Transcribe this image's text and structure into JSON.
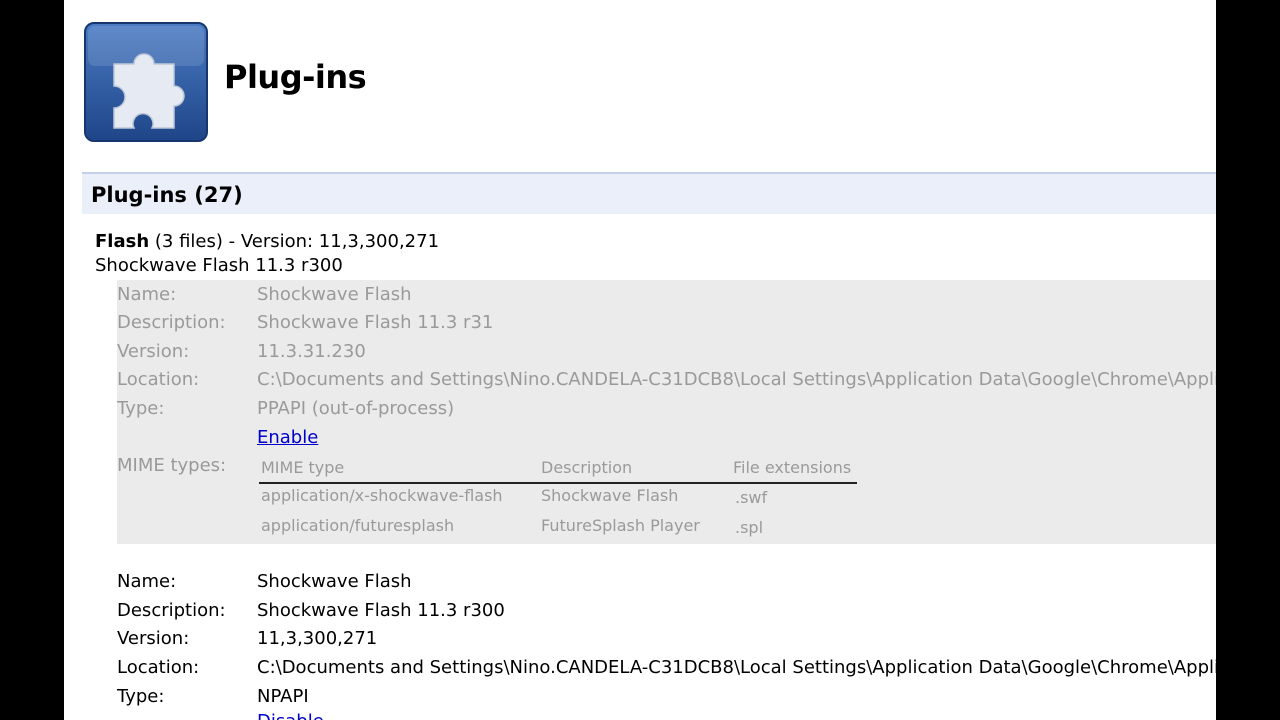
{
  "page": {
    "title": "Plug-ins",
    "logo_icon": "puzzle-piece-icon",
    "section_header": "Plug-ins (27)"
  },
  "plugin": {
    "name": "Flash",
    "files": "(3 files)",
    "version_text": " - Version: 11,3,300,271",
    "subtitle": "Shockwave Flash 11.3 r300"
  },
  "files": [
    {
      "state": "disabled",
      "labels": {
        "name": "Name:",
        "description": "Description:",
        "version": "Version:",
        "location": "Location:",
        "type": "Type:",
        "mime": "MIME types:"
      },
      "name": "Shockwave Flash",
      "description": "Shockwave Flash 11.3 r31",
      "version": "11.3.31.230",
      "location": "C:\\Documents and Settings\\Nino.CANDELA-C31DCB8\\Local Settings\\Application Data\\Google\\Chrome\\Application\\",
      "type": "PPAPI (out-of-process)",
      "action": "Enable",
      "mime_headers": [
        "MIME type",
        "Description",
        "File extensions"
      ],
      "mime_rows": [
        {
          "type": "application/x-shockwave-flash",
          "description": "Shockwave Flash",
          "ext": ".swf"
        },
        {
          "type": "application/futuresplash",
          "description": "FutureSplash Player",
          "ext": ".spl"
        }
      ]
    },
    {
      "state": "enabled",
      "labels": {
        "name": "Name:",
        "description": "Description:",
        "version": "Version:",
        "location": "Location:",
        "type": "Type:"
      },
      "name": "Shockwave Flash",
      "description": "Shockwave Flash 11.3 r300",
      "version": "11,3,300,271",
      "location": "C:\\Documents and Settings\\Nino.CANDELA-C31DCB8\\Local Settings\\Application Data\\Google\\Chrome\\Application\\",
      "type": "NPAPI",
      "action": "Disable"
    }
  ],
  "colors": {
    "logo_blue": "#2c5aa0",
    "link": "#0000cc",
    "disabled_bg": "#ebebeb",
    "disabled_text": "#9a9a9a",
    "header_bg": "#ebeff9"
  }
}
